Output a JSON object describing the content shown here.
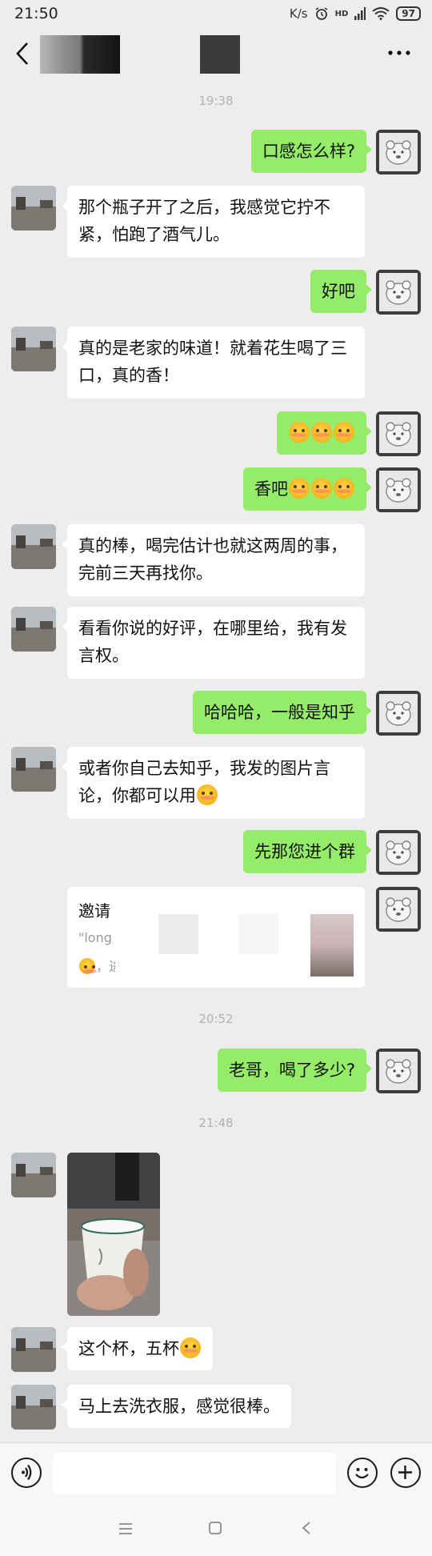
{
  "status": {
    "time": "21:50",
    "net": "K/s",
    "signal": "HD",
    "battery": "97"
  },
  "chat": {
    "time_1": "19:38",
    "time_2": "20:52",
    "time_3": "21:48",
    "messages": [
      {
        "side": "out",
        "text": "口感怎么样?"
      },
      {
        "side": "in",
        "text": "那个瓶子开了之后，我感觉它拧不紧，怕跑了酒气儿。"
      },
      {
        "side": "out",
        "text": "好吧"
      },
      {
        "side": "in",
        "text": "真的是老家的味道！就着花生喝了三口，真的香！"
      },
      {
        "side": "out",
        "text": ""
      },
      {
        "side": "out",
        "text": "香吧"
      },
      {
        "side": "in",
        "text": "真的棒，喝完估计也就这两周的事，完前三天再找你。"
      },
      {
        "side": "in",
        "text": "看看你说的好评，在哪里给，我有发言权。"
      },
      {
        "side": "out",
        "text": "哈哈哈，一般是知乎"
      },
      {
        "side": "in",
        "text": "或者你自己去知乎，我发的图片言论，你都可以用"
      },
      {
        "side": "out",
        "text": "先那您进个群"
      },
      {
        "side": "out",
        "text": "老哥，喝了多少?"
      },
      {
        "side": "in",
        "text": "这个杯，五杯"
      },
      {
        "side": "in",
        "text": "马上去洗衣服，感觉很棒。"
      }
    ],
    "invite_card": {
      "title": "邀请",
      "quote": "\"long",
      "line3": "，进"
    }
  },
  "colors": {
    "background": "#ededed",
    "bubble_out": "#95ec69",
    "bubble_in": "#ffffff",
    "timestamp": "#b2b2b2"
  },
  "icons": {
    "back": "chevron-left-icon",
    "more": "more-dots-icon",
    "voice": "voice-icon",
    "emoji": "smiley-icon",
    "plus": "plus-icon",
    "nav_menu": "menu-icon",
    "nav_home": "home-square-icon",
    "nav_back": "back-triangle-icon"
  }
}
